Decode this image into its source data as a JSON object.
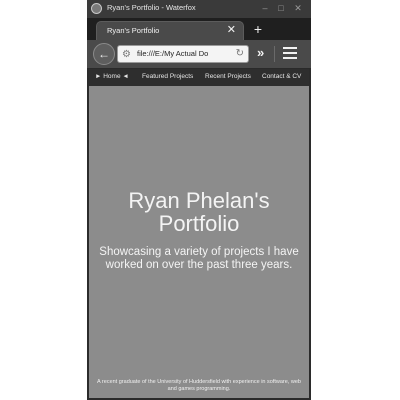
{
  "window": {
    "title": "Ryan's Portfolio - Waterfox"
  },
  "tab": {
    "label": "Ryan's Portfolio",
    "close_glyph": "✕",
    "new_tab_glyph": "+"
  },
  "navbar": {
    "back_glyph": "←",
    "url": "file:///E:/My Actual Do",
    "site_icon": "page-icon",
    "reload_glyph": "↻",
    "overflow_glyph": "»"
  },
  "site_nav": {
    "items": [
      "► Home ◄",
      "Featured Projects",
      "Recent Projects",
      "Contact & CV"
    ]
  },
  "hero": {
    "title": "Ryan Phelan's Portfolio",
    "subtitle": "Showcasing a variety of projects I have worked on over the past three years."
  },
  "footer": {
    "text": "A recent graduate of the University of Huddersfield with experience in software, web and games programming."
  },
  "colors": {
    "page_background": "#8c8c8c",
    "chrome_dark": "#2b2b2b",
    "text_light": "#f4f4f4"
  }
}
